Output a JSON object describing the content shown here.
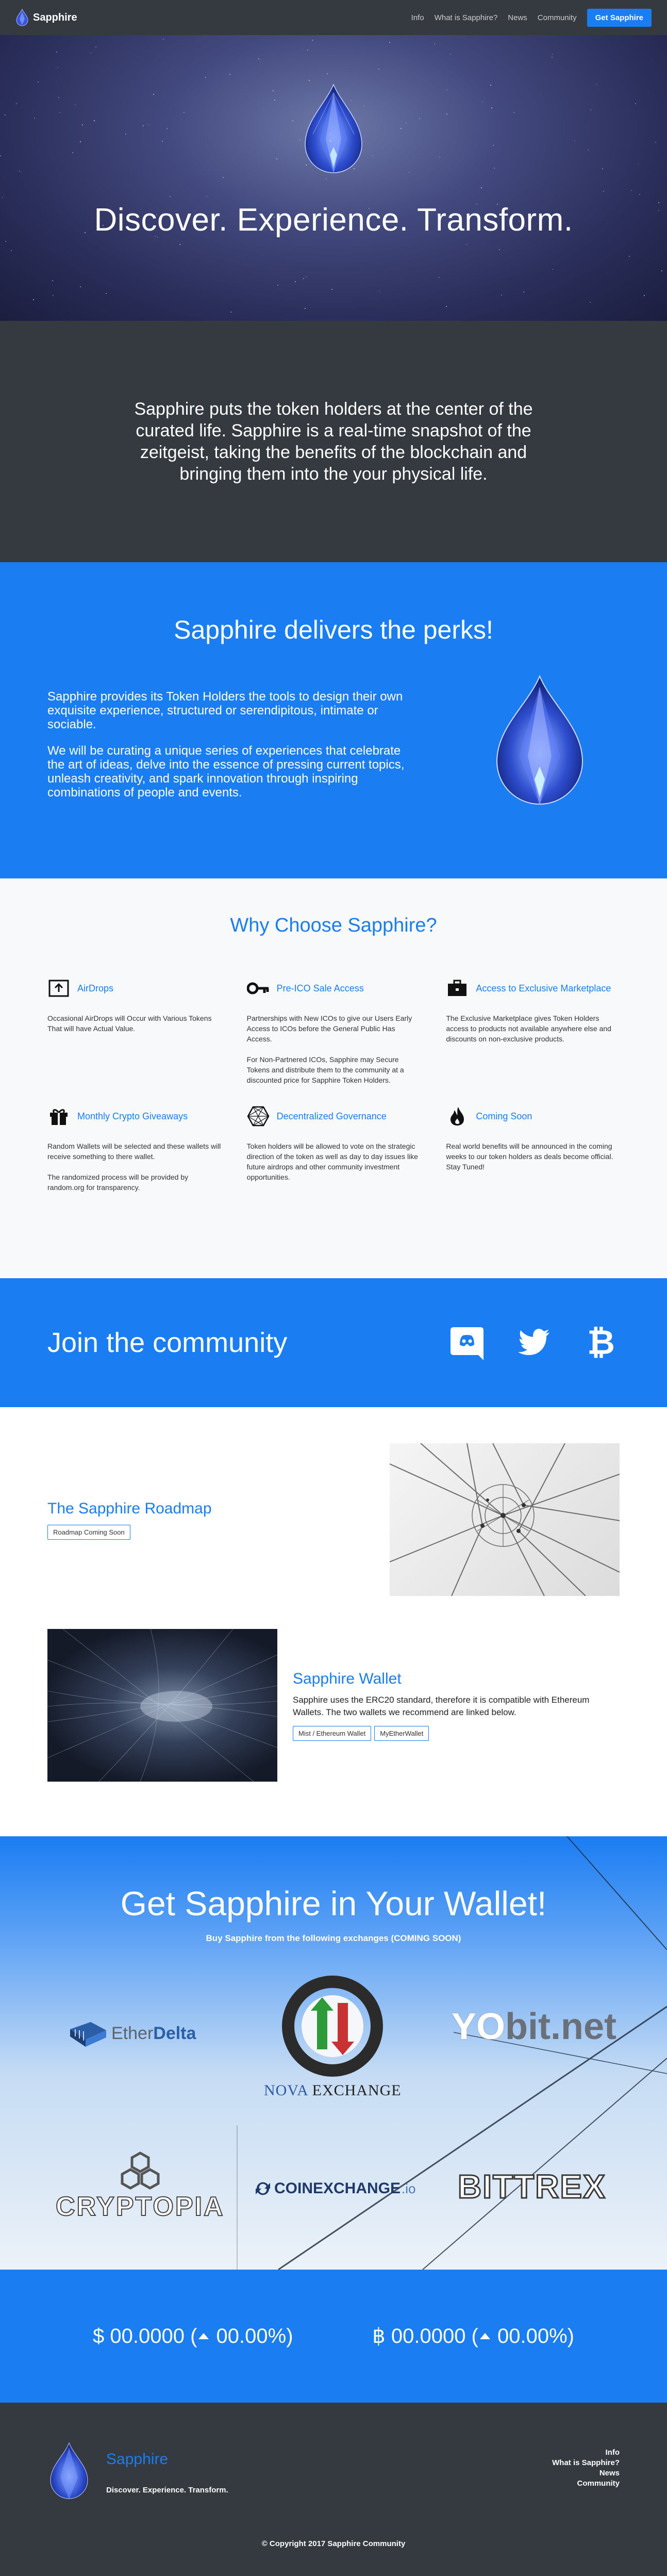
{
  "nav": {
    "brand": "Sapphire",
    "links": [
      "Info",
      "What is Sapphire?",
      "News",
      "Community"
    ],
    "cta": "Get Sapphire"
  },
  "hero": {
    "title": "Discover. Experience. Transform."
  },
  "intro": {
    "text": "Sapphire puts the token holders at the center of the curated life.  Sapphire is a real-time snapshot of the zeitgeist, taking the benefits of the blockchain and bringing them into the your physical life."
  },
  "perks": {
    "title": "Sapphire delivers the perks!",
    "p1": "Sapphire provides its Token Holders the tools to design their own exquisite experience, structured or serendipitous, intimate or sociable.",
    "p2": "We will be curating a unique series of experiences that celebrate the art of ideas, delve into the essence of pressing current topics, unleash creativity, and spark innovation through inspiring combinations of people and events."
  },
  "why": {
    "title": "Why Choose Sapphire?",
    "features": [
      {
        "title": "AirDrops",
        "icon": "upload-box-icon",
        "p1": "Occasional AirDrops will Occur with Various Tokens That will have Actual Value.",
        "p2": ""
      },
      {
        "title": "Pre-ICO Sale Access",
        "icon": "key-icon",
        "p1": "Partnerships with New ICOs to give our Users Early Access to ICOs before the General Public Has Access.",
        "p2": "For Non-Partnered ICOs, Sapphire may Secure Tokens and distribute them to the community at a discounted price for Sapphire Token Holders."
      },
      {
        "title": "Access to Exclusive Marketplace",
        "icon": "briefcase-icon",
        "p1": "The Exclusive Marketplace gives Token Holders access to products not available anywhere else and discounts on non-exclusive products.",
        "p2": ""
      },
      {
        "title": "Monthly Crypto Giveaways",
        "icon": "gift-icon",
        "p1": "Random Wallets will be selected and these wallets will receive something to there wallet.",
        "p2": "The randomized process will be provided by random.org for transparency."
      },
      {
        "title": "Decentralized Governance",
        "icon": "network-hexagon-icon",
        "p1": "Token holders will be allowed to vote on the strategic direction of the token as well as day to day issues like future airdrops and other community investment opportunities.",
        "p2": ""
      },
      {
        "title": "Coming Soon",
        "icon": "fire-icon",
        "p1": "Real world benefits will be announced in the coming weeks to our token holders as deals become official. Stay Tuned!",
        "p2": ""
      }
    ]
  },
  "community": {
    "title": "Join the community",
    "icons": [
      "discord-icon",
      "twitter-icon",
      "bitcoin-icon"
    ]
  },
  "roadmap": {
    "title": "The Sapphire Roadmap",
    "button": "Roadmap Coming Soon"
  },
  "wallet": {
    "title": "Sapphire Wallet",
    "text": "Sapphire uses the ERC20 standard, therefore it is compatible with Ethereum Wallets. The two wallets we recommend are linked below.",
    "btn1": "Mist / Ethereum Wallet",
    "btn2": "MyEtherWallet"
  },
  "exchanges": {
    "title": "Get Sapphire in Your Wallet!",
    "subtitle": "Buy Sapphire from the following exchanges (COMING SOON)",
    "logos": {
      "etherdelta_a": "Ether",
      "etherdelta_b": "Delta",
      "nova_a": "NOVA",
      "nova_b": "EXCHANGE",
      "yobit_a": "YO",
      "yobit_b": "bit.net",
      "cryptopia": "CRYPTOPIA",
      "coinexchange_a": "COINEXCHANGE",
      "coinexchange_b": ".io",
      "bittrex": "BITTREX"
    }
  },
  "prices": {
    "usd_symbol": "$",
    "usd_value": "00.0000",
    "usd_change": "00.00%",
    "btc_symbol": "฿",
    "btc_value": "00.0000",
    "btc_change": "00.00%"
  },
  "footer": {
    "name": "Sapphire",
    "tagline": "Discover. Experience. Transform.",
    "links": [
      "Info",
      "What is Sapphire?",
      "News",
      "Community"
    ],
    "copyright": "© Copyright 2017 Sapphire Community"
  },
  "colors": {
    "accent": "#1a7df2",
    "dark": "#343a40",
    "light": "#f8f9fa"
  }
}
